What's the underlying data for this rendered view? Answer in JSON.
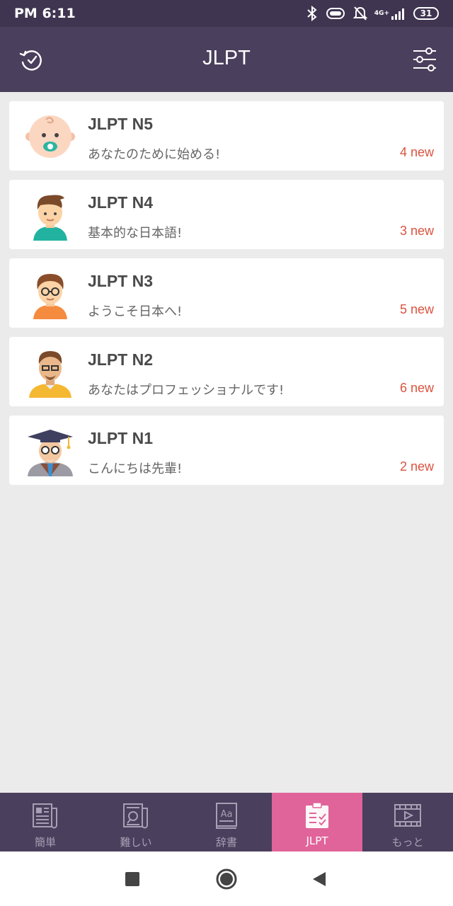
{
  "status": {
    "time": "PM 6:11",
    "network": "4G+",
    "battery": "31"
  },
  "header": {
    "title": "JLPT",
    "history_icon": "history-icon",
    "filter_icon": "sliders-icon"
  },
  "colors": {
    "header": "#4a3f5c",
    "accent": "#e0649a",
    "new_count": "#d9533f"
  },
  "levels": [
    {
      "title": "JLPT N5",
      "subtitle": "あなたのために始める!",
      "new_count": "4 new",
      "avatar": "baby-avatar"
    },
    {
      "title": "JLPT N4",
      "subtitle": "基本的な日本語!",
      "new_count": "3 new",
      "avatar": "boy-avatar"
    },
    {
      "title": "JLPT N3",
      "subtitle": "ようこそ日本へ!",
      "new_count": "5 new",
      "avatar": "glasses-boy-avatar"
    },
    {
      "title": "JLPT N2",
      "subtitle": "あなたはプロフェッショナルです!",
      "new_count": "6 new",
      "avatar": "man-avatar"
    },
    {
      "title": "JLPT N1",
      "subtitle": "こんにちは先輩!",
      "new_count": "2 new",
      "avatar": "professor-avatar"
    }
  ],
  "nav": [
    {
      "label": "簡単",
      "icon": "newspaper-icon"
    },
    {
      "label": "難しい",
      "icon": "newspaper-search-icon"
    },
    {
      "label": "辞書",
      "icon": "dictionary-icon"
    },
    {
      "label": "JLPT",
      "icon": "clipboard-check-icon",
      "active": true
    },
    {
      "label": "もっと",
      "icon": "video-icon"
    }
  ]
}
